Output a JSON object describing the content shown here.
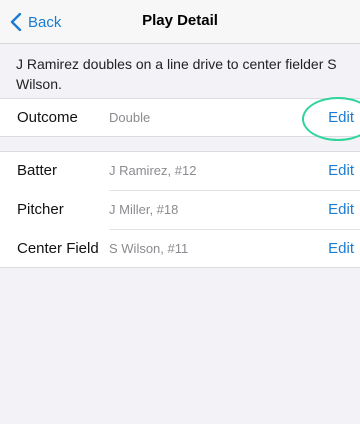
{
  "nav": {
    "back_label": "Back",
    "title": "Play Detail"
  },
  "description": "J Ramirez doubles on a line drive to center fielder S Wilson.",
  "outcome": {
    "label": "Outcome",
    "value": "Double",
    "edit_label": "Edit"
  },
  "players": [
    {
      "label": "Batter",
      "value": "J Ramirez, #12",
      "edit_label": "Edit"
    },
    {
      "label": "Pitcher",
      "value": "J Miller, #18",
      "edit_label": "Edit"
    },
    {
      "label": "Center Field",
      "value": "S Wilson, #11",
      "edit_label": "Edit"
    }
  ],
  "colors": {
    "accent": "#1b7cd3",
    "annotation": "#2fd49a",
    "background": "#f2f2f7"
  },
  "icons": {
    "back": "chevron-left-icon"
  }
}
